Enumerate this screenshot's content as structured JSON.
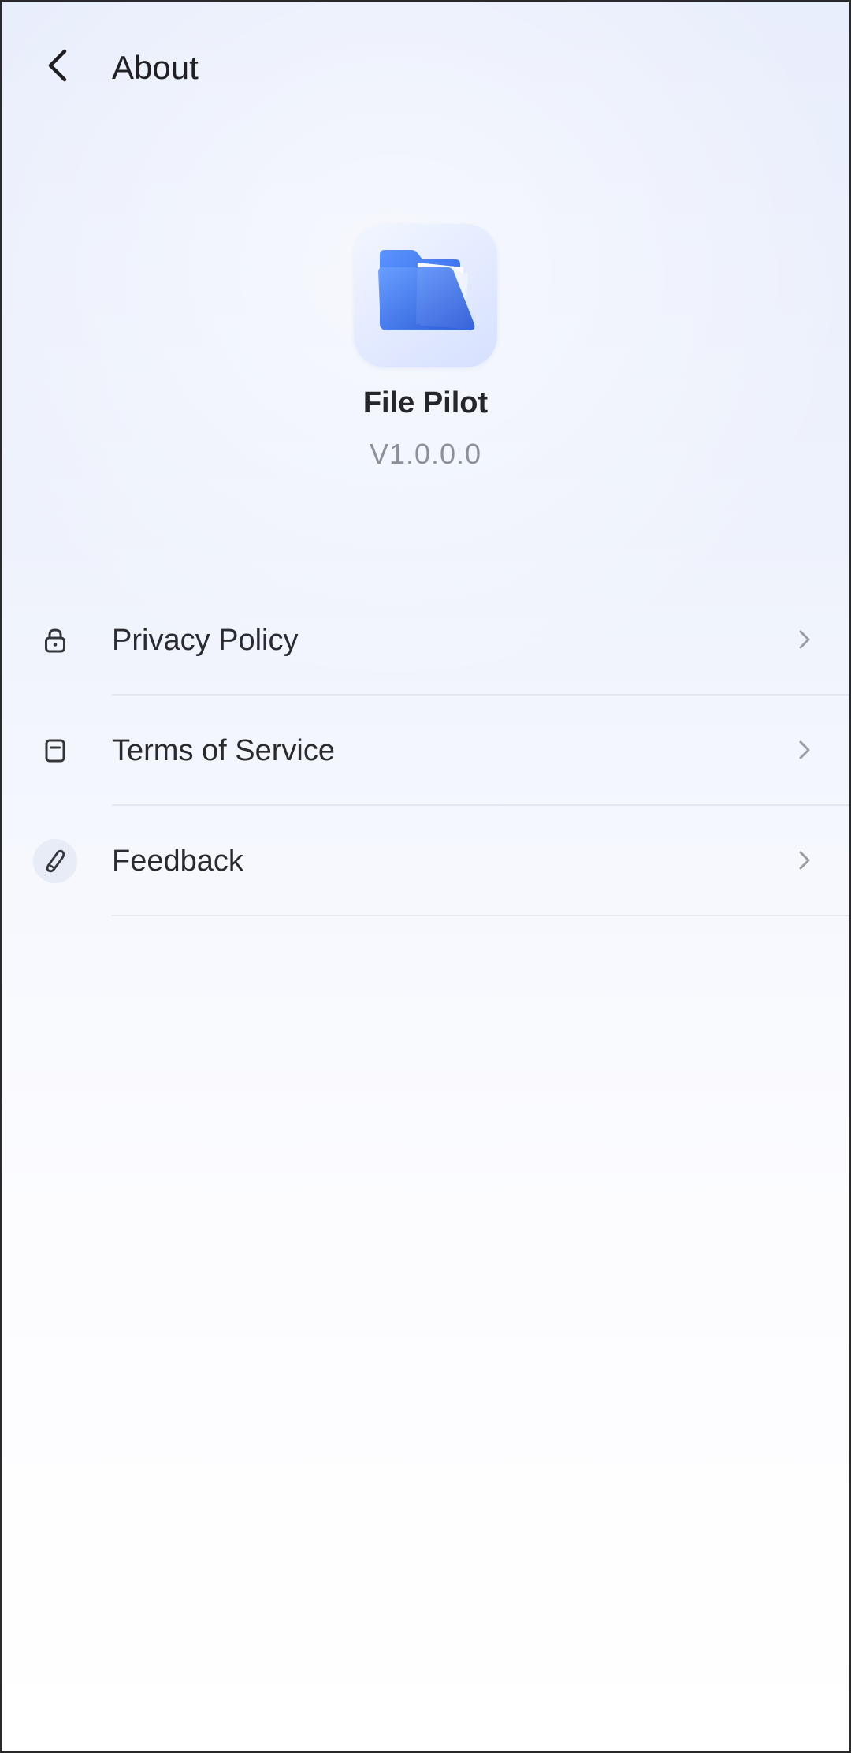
{
  "header": {
    "title": "About",
    "back_icon": "chevron-left-icon"
  },
  "app": {
    "name": "File Pilot",
    "version": "V1.0.0.0",
    "icon": "folder-icon"
  },
  "menu": {
    "items": [
      {
        "label": "Privacy Policy",
        "icon": "lock-icon"
      },
      {
        "label": "Terms of Service",
        "icon": "document-icon"
      },
      {
        "label": "Feedback",
        "icon": "pencil-icon"
      }
    ],
    "chevron_icon": "chevron-right-icon"
  },
  "colors": {
    "accent_blue": "#3f7bf0",
    "text_primary": "#25262b",
    "text_secondary": "#8e9097",
    "divider": "#e4e7ee"
  }
}
